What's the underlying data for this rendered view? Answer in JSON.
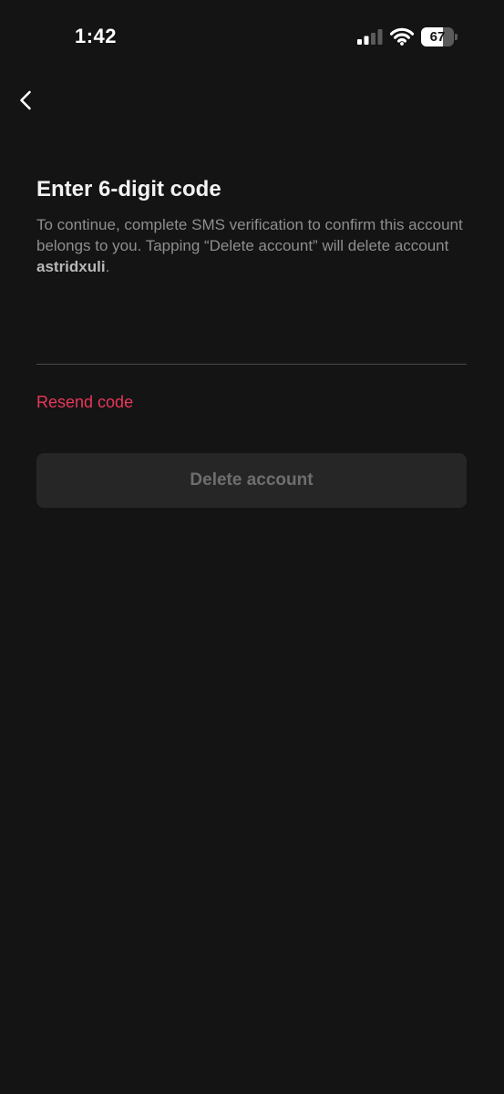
{
  "status_bar": {
    "time": "1:42",
    "battery_level": "67",
    "battery_fraction": 0.67,
    "icons": [
      "signal-icon",
      "wifi-icon",
      "battery-icon"
    ]
  },
  "header": {
    "back_icon": "chevron-left-icon"
  },
  "main": {
    "title": "Enter 6-digit code",
    "description_prefix": "To continue, complete SMS verification to confirm this account belongs to you. Tapping “Delete account” will delete account ",
    "username": "astridxuli",
    "description_suffix": ".",
    "code_value": "",
    "code_placeholder": "",
    "resend_label": "Resend code",
    "delete_label": "Delete account"
  },
  "colors": {
    "background": "#141414",
    "accent": "#e8375a",
    "button_disabled_bg": "#262626",
    "button_disabled_text": "#6e6e6e"
  }
}
